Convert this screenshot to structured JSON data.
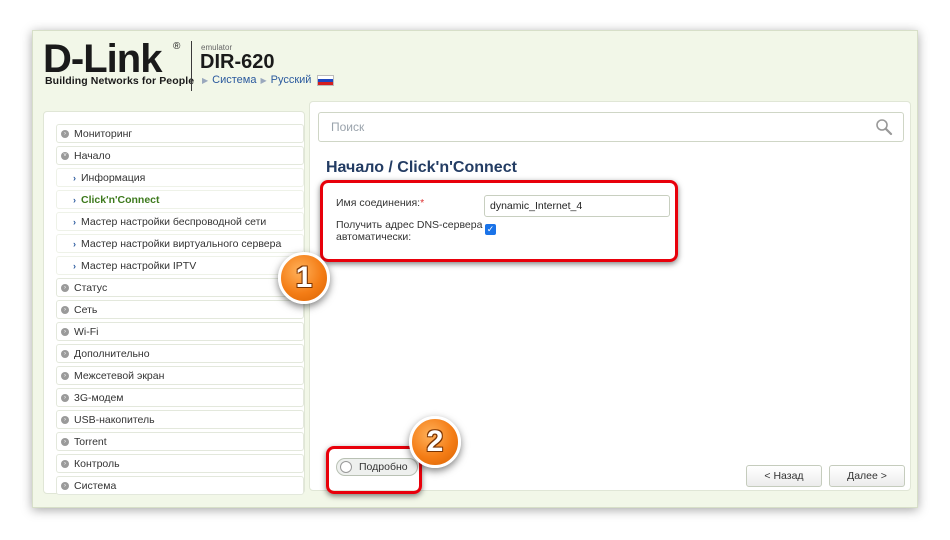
{
  "header": {
    "brand": "D-Link",
    "registered": "®",
    "tagline": "Building Networks for People",
    "emulator": "emulator",
    "model": "DIR-620",
    "crumbs": [
      "Система",
      "Русский"
    ]
  },
  "sidebar": {
    "items": [
      {
        "label": "Мониторинг",
        "type": "section"
      },
      {
        "label": "Начало",
        "type": "section-open"
      },
      {
        "label": "Информация",
        "type": "sub"
      },
      {
        "label": "Click'n'Connect",
        "type": "sub-active"
      },
      {
        "label": "Мастер настройки беспроводной сети",
        "type": "sub"
      },
      {
        "label": "Мастер настройки виртуального сервера",
        "type": "sub"
      },
      {
        "label": "Мастер настройки IPTV",
        "type": "sub"
      },
      {
        "label": "Статус",
        "type": "section"
      },
      {
        "label": "Сеть",
        "type": "section"
      },
      {
        "label": "Wi-Fi",
        "type": "section"
      },
      {
        "label": "Дополнительно",
        "type": "section"
      },
      {
        "label": "Межсетевой экран",
        "type": "section"
      },
      {
        "label": "3G-модем",
        "type": "section"
      },
      {
        "label": "USB-накопитель",
        "type": "section"
      },
      {
        "label": "Torrent",
        "type": "section"
      },
      {
        "label": "Контроль",
        "type": "section"
      },
      {
        "label": "Система",
        "type": "section"
      }
    ]
  },
  "search": {
    "placeholder": "Поиск",
    "icon": "search-icon"
  },
  "page": {
    "title": "Начало /  Click'n'Connect",
    "connection_name_label": "Имя соединения:",
    "required_mark": "*",
    "connection_name_value": "dynamic_Internet_4",
    "dns_label_line1": "Получить адрес DNS-сервера",
    "dns_label_line2": "автоматически:",
    "dns_checked": true
  },
  "footer": {
    "details_toggle": "Подробно",
    "back_button": "< Назад",
    "next_button": "Далее >"
  },
  "annotations": {
    "badge1": "1",
    "badge2": "2",
    "color": "#e8000b"
  }
}
